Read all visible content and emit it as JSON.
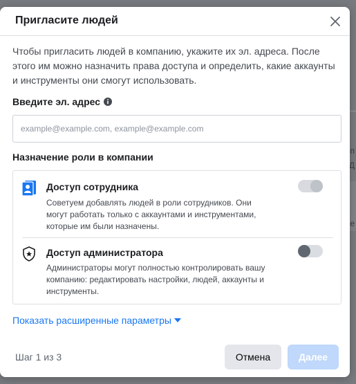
{
  "background": {
    "right_text_1": "п",
    "right_text_2": "Д",
    "right_text_3": "е"
  },
  "modal": {
    "title": "Пригласите людей",
    "close_icon": "close-icon",
    "intro": "Чтобы пригласить людей в компанию, укажите их эл. адреса. После этого им можно назначить права доступа и определить, какие аккаунты и инструменты они смогут использовать.",
    "email": {
      "label": "Введите эл. адрес",
      "placeholder": "example@example.com, example@example.com",
      "value": ""
    },
    "roles": {
      "heading": "Назначение роли в компании",
      "items": [
        {
          "icon": "employee-badge-icon",
          "title": "Доступ сотрудника",
          "description": "Советуем добавлять людей в роли сотрудников. Они могут работать только с аккаунтами и инструментами, которые им были назначены.",
          "enabled": true
        },
        {
          "icon": "admin-shield-icon",
          "title": "Доступ администратора",
          "description": "Администраторы могут полностью контролировать вашу компанию: редактировать настройки, людей, аккаунты и инструменты.",
          "enabled": false
        }
      ]
    },
    "advanced_link": "Показать расширенные параметры",
    "step": "Шаг 1 из 3",
    "buttons": {
      "cancel": "Отмена",
      "next": "Далее"
    },
    "colors": {
      "accent": "#1877f2",
      "next_disabled": "#bfd8fb"
    }
  }
}
